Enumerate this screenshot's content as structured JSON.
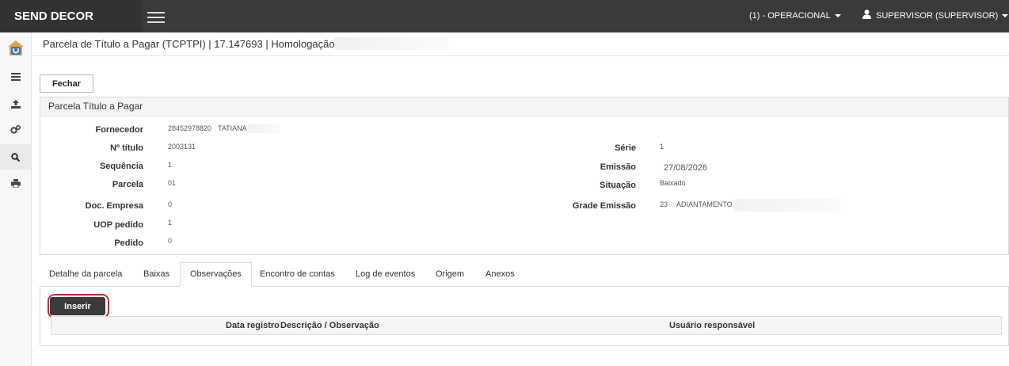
{
  "app": {
    "brand": "SEND DECOR"
  },
  "topbar": {
    "profile": "(1) - OPERACIONAL",
    "user": "SUPERVISOR (SUPERVISOR)"
  },
  "sidebar": {
    "items": [
      {
        "icon": "home-logo-icon"
      },
      {
        "icon": "list-icon"
      },
      {
        "icon": "upload-icon"
      },
      {
        "icon": "gears-icon"
      },
      {
        "icon": "search-icon",
        "active": true
      },
      {
        "icon": "print-icon"
      }
    ]
  },
  "header": {
    "title": "Parcela de Título a Pagar (TCPTPI) | 17.147693 | Homologação |"
  },
  "toolbar": {
    "close_label": "Fechar"
  },
  "panel": {
    "title": "Parcela Título a Pagar",
    "left_fields": [
      {
        "label": "Fornecedor",
        "value": "28452978820",
        "value2": "TATIANA"
      },
      {
        "label": "Nº título",
        "value": "2003131"
      },
      {
        "label": "Sequência",
        "value": "1"
      },
      {
        "label": "Parcela",
        "value": "01"
      },
      {
        "label": "Doc. Empresa",
        "value": "0"
      },
      {
        "label": "UOP pedido",
        "value": "1"
      },
      {
        "label": "Pedido",
        "value": "0"
      }
    ],
    "right_fields": [
      {
        "label": "Série",
        "value": "1"
      },
      {
        "label": "Emissão",
        "value": "27/08/2026"
      },
      {
        "label": "Situação",
        "value": "Baixado"
      },
      {
        "label": "Grade Emissão",
        "value": "23",
        "value2": "ADIANTAMENTO E"
      }
    ]
  },
  "tabs": [
    {
      "label": "Detalhe da parcela"
    },
    {
      "label": "Baixas"
    },
    {
      "label": "Observações",
      "active": true
    },
    {
      "label": "Encontro de contas"
    },
    {
      "label": "Log de eventos"
    },
    {
      "label": "Origem"
    },
    {
      "label": "Anexos"
    }
  ],
  "observations": {
    "insert_label": "Inserir",
    "columns": [
      "Data registro",
      "Descrição / Observação",
      "Usuário responsável"
    ]
  },
  "colors": {
    "topbar": "#3a3a3a",
    "brand_bg": "#333333",
    "button_dark": "#3b3b3b",
    "highlight": "#d9232d"
  }
}
